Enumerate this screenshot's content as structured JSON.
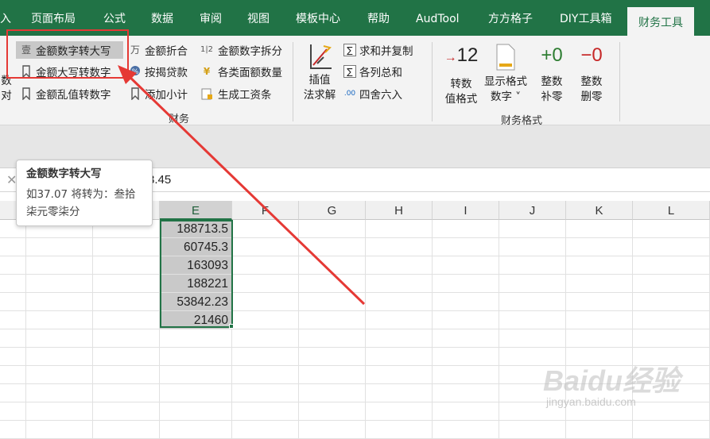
{
  "tabs": [
    {
      "label": "入"
    },
    {
      "label": "页面布局"
    },
    {
      "label": "公式"
    },
    {
      "label": "数据"
    },
    {
      "label": "审阅"
    },
    {
      "label": "视图"
    },
    {
      "label": "模板中心"
    },
    {
      "label": "帮助"
    },
    {
      "label": "AudTool"
    },
    {
      "label": "方方格子"
    },
    {
      "label": "DIY工具箱"
    },
    {
      "label": "财务工具",
      "active": true
    }
  ],
  "ribbon": {
    "left_cut_labels": [
      "数",
      "对"
    ],
    "col1": [
      "金额数字转大写",
      "金额大写转数字",
      "金额乱值转数字"
    ],
    "col1_icons": [
      "壹",
      "",
      ""
    ],
    "col2": [
      "金额折合",
      "按揭贷款",
      "添加小计"
    ],
    "col2_icons": [
      "万",
      "",
      ""
    ],
    "col3": [
      "金额数字拆分",
      "各类面额数量",
      "生成工资条"
    ],
    "col3_icons": [
      "1|2",
      "¥",
      ""
    ],
    "big_insert": "插值\n法求解",
    "col4": [
      "求和并复制",
      "各列总和",
      "四舍六入"
    ],
    "col4_icons": [
      "∑",
      "∑",
      ".00"
    ],
    "group_finance_label": "财务",
    "fmt_buttons": [
      {
        "symbol": "→12",
        "label": "转数\n值格式",
        "color": "#c62828"
      },
      {
        "symbol": "",
        "label": "显示格式\n数字 ˅",
        "color": "#e6a817"
      },
      {
        "symbol": "+0",
        "label": "整数\n补零",
        "color": "#2e7d32"
      },
      {
        "symbol": "−0",
        "label": "整数\n删零",
        "color": "#c62828"
      }
    ],
    "group_fmt_label": "财务格式"
  },
  "formula_bar": {
    "cancel_icon": "close-icon",
    "value": "3.45"
  },
  "grid": {
    "columns": [
      "E",
      "F",
      "G",
      "H",
      "I",
      "J",
      "K",
      "L"
    ],
    "selected_column": "E",
    "values": [
      "188713.5",
      "60745.3",
      "163093",
      "188221",
      "53842.23",
      "21460"
    ]
  },
  "tooltip": {
    "title": "金额数字转大写",
    "description": "如37.07 将转为：叁拾柒元零柒分"
  },
  "annotation": {
    "color": "#e53935"
  },
  "watermark": {
    "main": "Baidu经验",
    "sub": "jingyan.baidu.com"
  }
}
